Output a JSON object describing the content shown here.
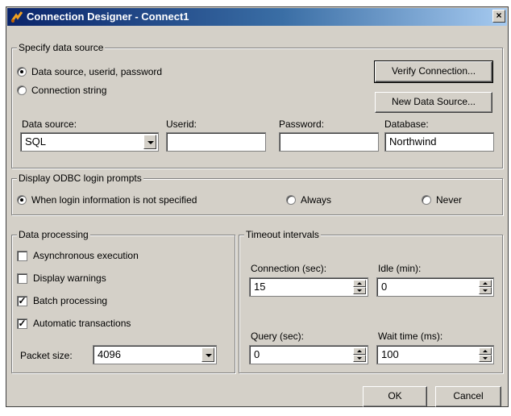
{
  "window": {
    "title": "Connection Designer - Connect1",
    "close_glyph": "×"
  },
  "data_source_group": {
    "legend": "Specify data source",
    "radio_userid": "Data source, userid, password",
    "radio_connstr": "Connection string",
    "verify_button": "Verify Connection...",
    "new_source_button": "New Data Source...",
    "labels": {
      "data_source": "Data source:",
      "userid": "Userid:",
      "password": "Password:",
      "database": "Database:"
    },
    "values": {
      "data_source": "SQL",
      "userid": "",
      "password": "",
      "database": "Northwind"
    }
  },
  "odbc_group": {
    "legend": "Display ODBC login prompts",
    "options": [
      "When login information is not specified",
      "Always",
      "Never"
    ],
    "selected": 0
  },
  "processing_group": {
    "legend": "Data processing",
    "checks": [
      {
        "label": "Asynchronous execution",
        "checked": false
      },
      {
        "label": "Display warnings",
        "checked": false
      },
      {
        "label": "Batch processing",
        "checked": true
      },
      {
        "label": "Automatic transactions",
        "checked": true
      }
    ],
    "packet_label": "Packet size:",
    "packet_value": "4096"
  },
  "timeout_group": {
    "legend": "Timeout intervals",
    "connection_label": "Connection (sec):",
    "connection_value": "15",
    "idle_label": "Idle (min):",
    "idle_value": "0",
    "query_label": "Query (sec):",
    "query_value": "0",
    "wait_label": "Wait time (ms):",
    "wait_value": "100"
  },
  "buttons": {
    "ok": "OK",
    "cancel": "Cancel"
  },
  "icons": {
    "app": "connection-designer-icon",
    "check": "✓"
  },
  "colors": {
    "titlebar_start": "#0a246a",
    "face": "#d4d0c8"
  }
}
